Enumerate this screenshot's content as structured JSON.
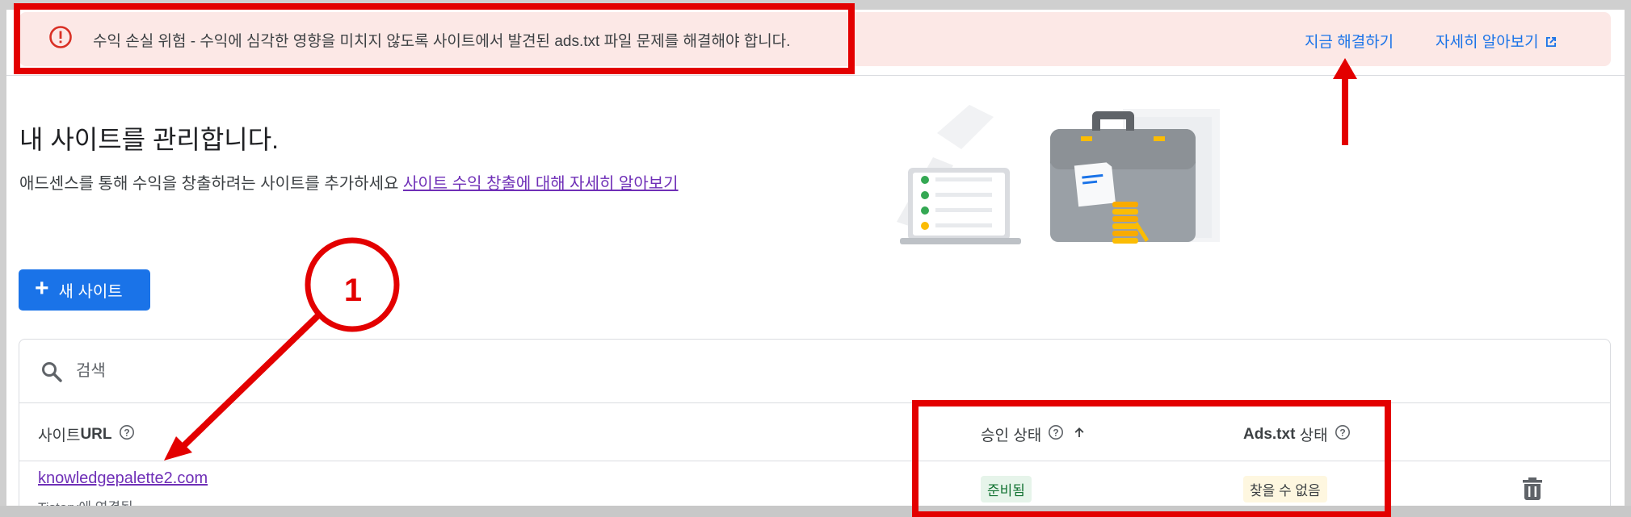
{
  "alert": {
    "message": "수익 손실 위험 - 수익에 심각한 영향을 미치지 않도록 사이트에서 발견된 ads.txt 파일 문제를 해결해야 합니다.",
    "fix_link": "지금 해결하기",
    "learn_link": "자세히 알아보기",
    "icon": "error-icon"
  },
  "header": {
    "title": "내 사이트를 관리합니다.",
    "subtitle_text": "애드센스를 통해 수익을 창출하려는 사이트를 추가하세요 ",
    "subtitle_link": "사이트 수익 창출에 대해 자세히 알아보기"
  },
  "actions": {
    "new_site_label": "새 사이트"
  },
  "search": {
    "placeholder": "검색"
  },
  "table": {
    "columns": [
      {
        "label_plain": "사이트 ",
        "label_bold": "URL"
      },
      {
        "label_plain": "승인 상태",
        "label_bold": ""
      },
      {
        "label_plain": "",
        "label_bold": "Ads.txt",
        "label_after": " 상태"
      }
    ],
    "rows": [
      {
        "url": "knowledgepalette2.com",
        "connection": "Tistory에 연결됨",
        "approval_status": "준비됨",
        "ads_txt_status": "찾을 수 없음"
      }
    ]
  },
  "annotations": {
    "callout_number": "1"
  },
  "colors": {
    "accent": "#1a73e8",
    "alert_bg": "#fce8e6",
    "error": "#d93025",
    "annotation_red": "#e30000",
    "ready_chip": "#e6f4ea",
    "notfound_chip": "#fef7e0"
  }
}
